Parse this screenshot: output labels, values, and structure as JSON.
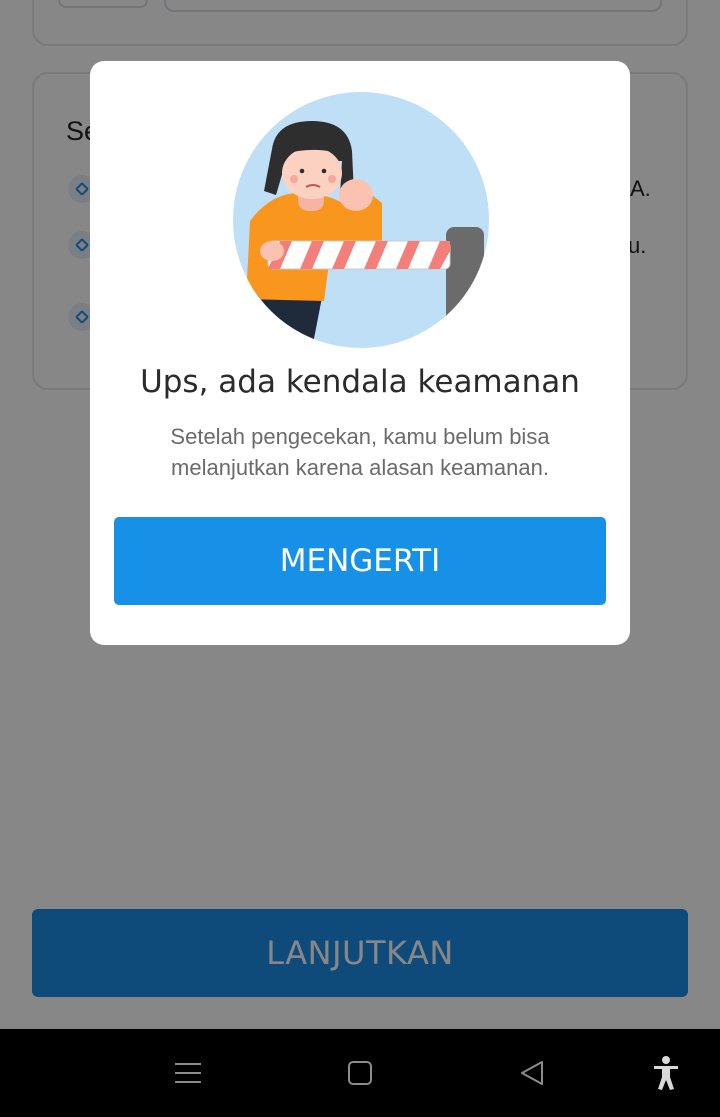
{
  "background": {
    "section_title": "Se",
    "rows": [
      {
        "trailing_text": "A."
      },
      {
        "trailing_text": "u."
      },
      {
        "trailing_text": ""
      }
    ],
    "continue_button_label": "LANJUTKAN"
  },
  "modal": {
    "illustration": "woman-behind-security-barrier-illustration",
    "title": "Ups, ada kendala keamanan",
    "description": "Setelah pengecekan, kamu belum bisa melanjutkan karena alasan keamanan.",
    "confirm_button_label": "MENGERTI"
  },
  "nav_bar": {
    "icons": [
      "menu-icon",
      "home-icon",
      "back-icon",
      "accessibility-icon"
    ]
  },
  "colors": {
    "primary": "#1790e8",
    "scrim": "rgba(0,0,0,0.47)",
    "illustration_bg": "#bfdff7",
    "shirt": "#f8961e"
  }
}
